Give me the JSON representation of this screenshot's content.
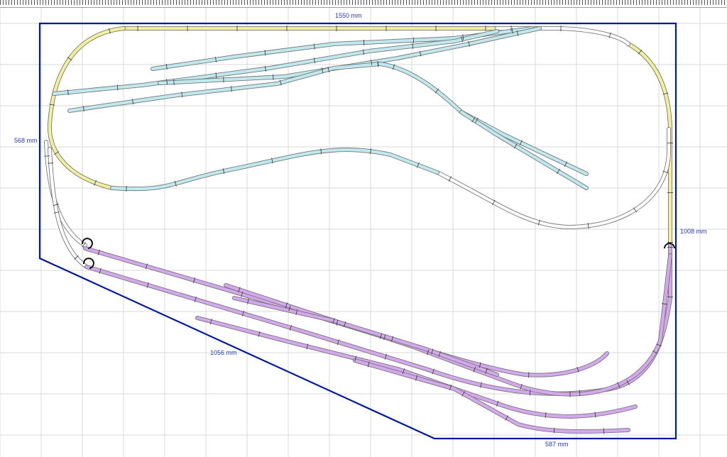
{
  "canvas": {
    "background": "#ffffff",
    "grid_color": "#d9d9d9"
  },
  "board": {
    "outline_color": "#001a9e"
  },
  "dimensions": {
    "top": "1550 mm",
    "left": "568 mm",
    "right": "1008 mm",
    "diagonal": "1056 mm",
    "bottom": "587 mm"
  },
  "track_colors": {
    "main_line": "#f3f09a",
    "upper_level": "#bfe9ee",
    "lower_level": "#d3a8ec",
    "connector": "#ffffff",
    "rail": "#777777"
  }
}
